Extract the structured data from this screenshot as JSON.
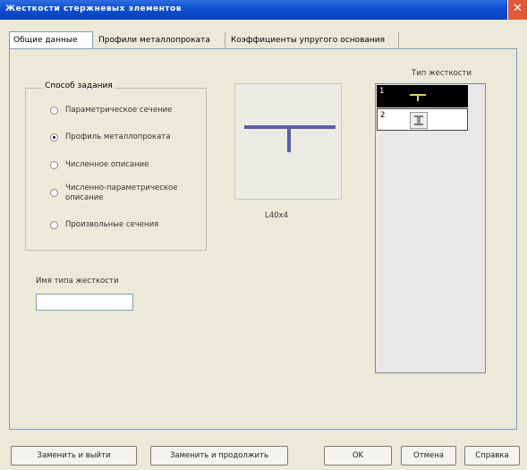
{
  "window": {
    "title": "Жесткости стержневых элементов"
  },
  "tabs": [
    {
      "label": "Общие данные"
    },
    {
      "label": "Профили металлопроката"
    },
    {
      "label": "Коэффициенты упругого основания"
    }
  ],
  "group": {
    "title": "Способ задания",
    "options": [
      {
        "label": "Параметрическое сечение",
        "checked": false
      },
      {
        "label": "Профиль металлопроката",
        "checked": true
      },
      {
        "label": "Численное описание",
        "checked": false
      },
      {
        "label": "Численно-параметрическое описание",
        "checked": false
      },
      {
        "label": "Произвольные сечения",
        "checked": false
      }
    ]
  },
  "preview": {
    "label": "L40x4",
    "color": "#5b5ea6"
  },
  "types": {
    "header": "Тип жесткости",
    "rows": [
      {
        "number": "1",
        "selected": true,
        "icon": "angle-profile-icon"
      },
      {
        "number": "2",
        "selected": false,
        "icon": "parametric-section-icon"
      }
    ]
  },
  "name_field": {
    "label": "Имя типа жесткости",
    "value": ""
  },
  "buttons": {
    "save_exit": "Заменить и выйти",
    "save_continue": "Заменить и продолжить",
    "ok": "OK",
    "cancel": "Отмена",
    "help": "Справка"
  }
}
